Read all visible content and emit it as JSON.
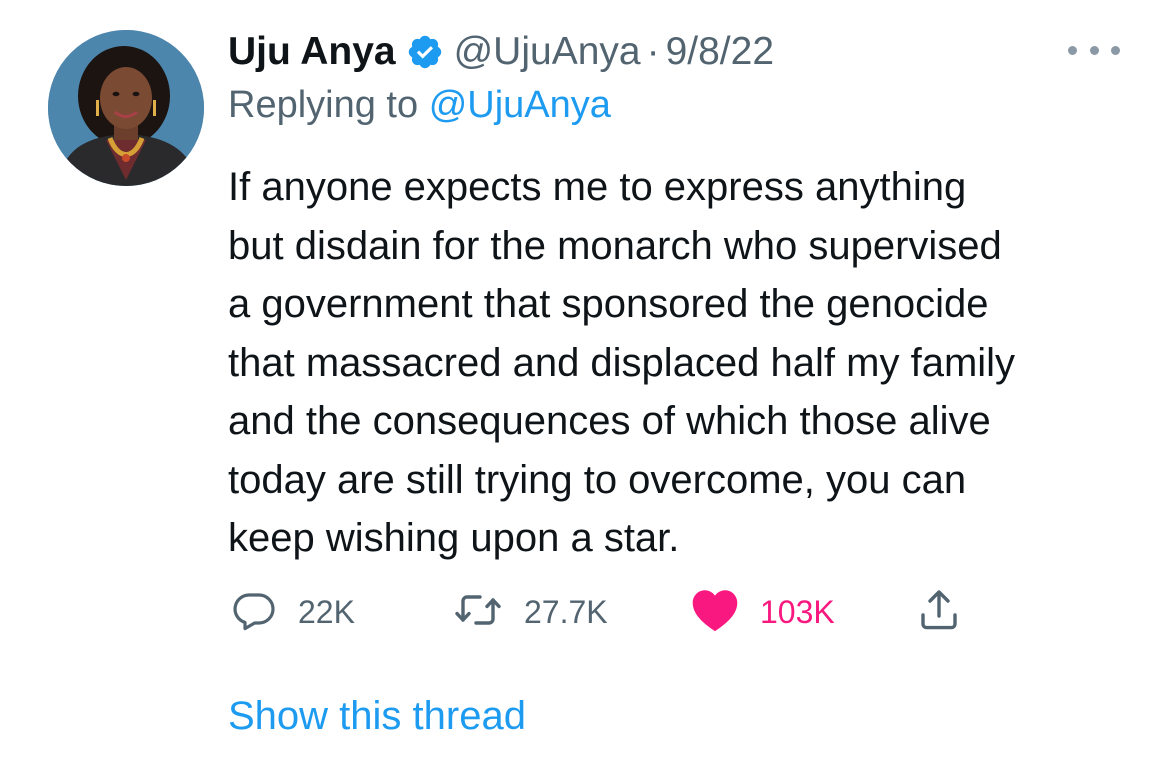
{
  "author": {
    "display_name": "Uju Anya",
    "handle": "@UjuAnya",
    "verified": true
  },
  "date": "9/8/22",
  "separator": "·",
  "reply": {
    "prefix": "Replying to",
    "handle": "@UjuAnya"
  },
  "text_lines": [
    "If anyone expects me to express anything",
    "but disdain for the monarch who supervised",
    "a government that sponsored the genocide",
    "that massacred and displaced half my family",
    "and the consequences of which those alive",
    "today are still trying to overcome, you can",
    "keep wishing upon a star."
  ],
  "actions": {
    "replies": "22K",
    "retweets": "27.7K",
    "likes": "103K"
  },
  "show_thread": "Show this thread",
  "icons": {
    "verified": "verified-badge-icon",
    "more": "more-options-icon",
    "reply": "reply-bubble-icon",
    "retweet": "retweet-icon",
    "like": "heart-icon",
    "share": "share-icon"
  },
  "colors": {
    "text": "#0f1419",
    "secondary": "#536471",
    "link": "#1d9bf0",
    "like": "#f91880",
    "verified": "#1d9bf0"
  }
}
